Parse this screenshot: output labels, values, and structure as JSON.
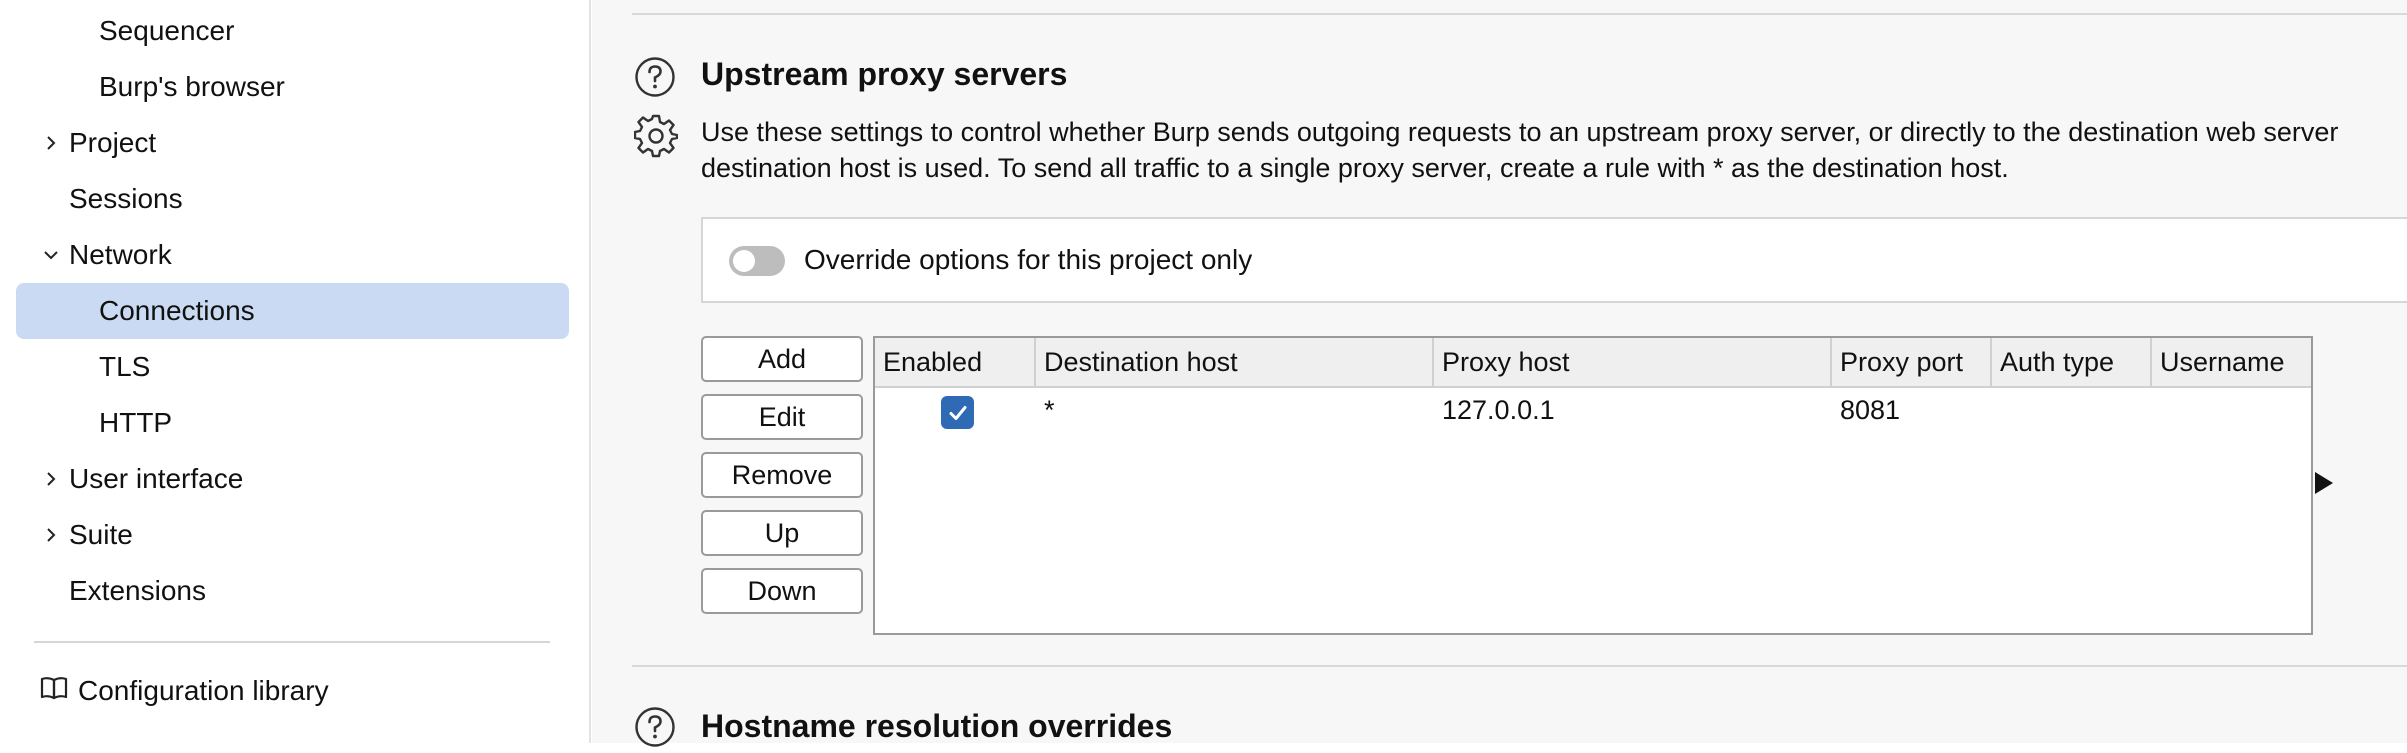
{
  "sidebar": {
    "items": [
      {
        "label": "Sequencer"
      },
      {
        "label": "Burp's browser"
      },
      {
        "label": "Project"
      },
      {
        "label": "Sessions"
      },
      {
        "label": "Network"
      },
      {
        "label": "Connections"
      },
      {
        "label": "TLS"
      },
      {
        "label": "HTTP"
      },
      {
        "label": "User interface"
      },
      {
        "label": "Suite"
      },
      {
        "label": "Extensions"
      }
    ],
    "selected": "Connections",
    "footer_label": "Configuration library"
  },
  "upstream": {
    "title": "Upstream proxy servers",
    "description_line1": "Use these settings to control whether Burp sends outgoing requests to an upstream proxy server, or directly to the destination web server",
    "description_line2": "destination host is used. To send all traffic to a single proxy server, create a rule with * as the destination host.",
    "override_label": "Override options for this project only",
    "override_enabled": false,
    "buttons": {
      "add": "Add",
      "edit": "Edit",
      "remove": "Remove",
      "up": "Up",
      "down": "Down"
    },
    "table": {
      "columns": [
        "Enabled",
        "Destination host",
        "Proxy host",
        "Proxy port",
        "Auth type",
        "Username"
      ],
      "rows": [
        {
          "enabled": true,
          "destination_host": "*",
          "proxy_host": "127.0.0.1",
          "proxy_port": "8081",
          "auth_type": "",
          "username": ""
        }
      ]
    }
  },
  "hostname": {
    "title": "Hostname resolution overrides"
  },
  "colors": {
    "selected_bg": "#c9daf2",
    "checkbox_blue": "#2f6bb5"
  },
  "icons": [
    "chevron-right-icon",
    "chevron-down-icon",
    "book-icon",
    "help-icon",
    "settings-gear-icon",
    "checkmark-icon",
    "scroll-right-arrow-icon"
  ]
}
